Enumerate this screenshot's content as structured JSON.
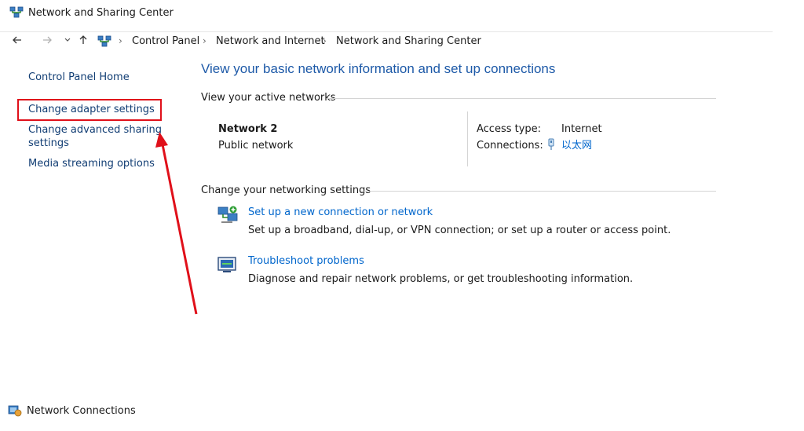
{
  "window": {
    "title": "Network and Sharing Center",
    "icon": "network-icon"
  },
  "address_bar": {
    "back_icon": "arrow-left-icon",
    "forward_icon": "arrow-right-icon",
    "recent_icon": "chevron-down-icon",
    "up_icon": "arrow-up-icon",
    "breadcrumbs": [
      "Control Panel",
      "Network and Internet",
      "Network and Sharing Center"
    ],
    "separator": "›"
  },
  "sidebar": {
    "items": [
      {
        "label": "Control Panel Home"
      },
      {
        "label": "Change adapter settings",
        "highlighted": true
      },
      {
        "label_line1": "Change advanced sharing",
        "label_line2": "settings"
      },
      {
        "label": "Media streaming options"
      }
    ]
  },
  "main": {
    "heading": "View your basic network information and set up connections",
    "active_networks": {
      "section_label": "View your active networks",
      "network_name": "Network 2",
      "network_type": "Public network",
      "access_type_label": "Access type:",
      "access_type_value": "Internet",
      "connections_label": "Connections:",
      "connections_value": "以太网",
      "connections_icon": "ethernet-icon"
    },
    "networking_settings": {
      "section_label": "Change your networking settings",
      "items": [
        {
          "link": "Set up a new connection or network",
          "description": "Set up a broadband, dial-up, or VPN connection; or set up a router or access point.",
          "icon": "new-connection-icon"
        },
        {
          "link": "Troubleshoot problems",
          "description": "Diagnose and repair network problems, or get troubleshooting information.",
          "icon": "troubleshoot-icon"
        }
      ]
    }
  },
  "annotation": {
    "highlight_color": "#e0101a"
  },
  "second_window": {
    "title": "Network Connections",
    "icon": "network-connections-icon"
  }
}
